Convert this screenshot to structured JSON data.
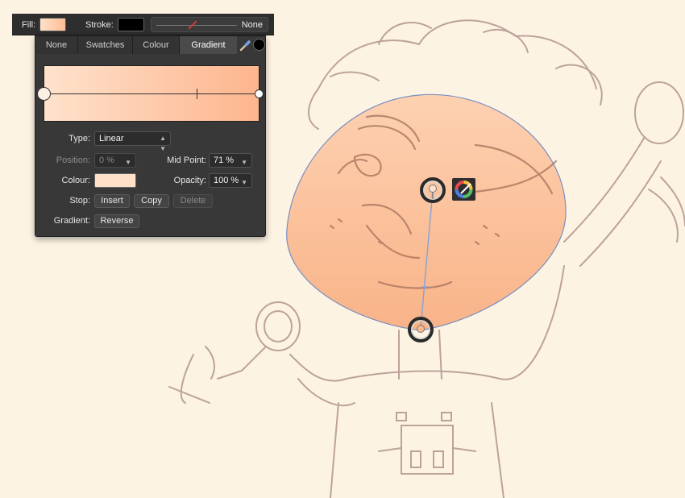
{
  "toolbar": {
    "fill_label": "Fill:",
    "stroke_label": "Stroke:",
    "stroke_width_value": "None",
    "fill_colors": [
      "#ffe0c8",
      "#fdbd96"
    ],
    "stroke_color": "#000000"
  },
  "panel": {
    "tabs": [
      {
        "label": "None"
      },
      {
        "label": "Swatches"
      },
      {
        "label": "Colour"
      },
      {
        "label": "Gradient"
      }
    ],
    "active_tab": "Gradient",
    "gradient": {
      "start_color": "#ffe2cc",
      "end_color": "#fdb58d",
      "mid_point_fraction": 0.71
    },
    "type_label": "Type:",
    "type_value": "Linear",
    "position_label": "Position:",
    "position_value": "0 %",
    "midpoint_label": "Mid Point:",
    "midpoint_value": "71 %",
    "colour_label": "Colour:",
    "colour_value": "#ffe0c8",
    "opacity_label": "Opacity:",
    "opacity_value": "100 %",
    "stop_label": "Stop:",
    "insert_label": "Insert",
    "copy_label": "Copy",
    "delete_label": "Delete",
    "gradient_label": "Gradient:",
    "reverse_label": "Reverse"
  },
  "canvas": {
    "head_fill_top": "#fcc8a2",
    "head_fill_bottom": "#f9ae7e",
    "selection_color": "#7a8fc0",
    "sketch_color": "#a88a86"
  }
}
